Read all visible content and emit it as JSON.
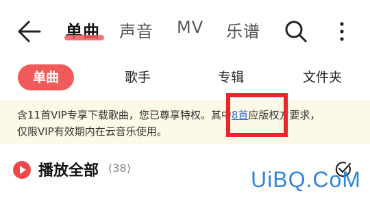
{
  "header": {
    "tabs": [
      {
        "label": "单曲"
      },
      {
        "label": "声音"
      },
      {
        "label": "MV"
      },
      {
        "label": "乐谱"
      }
    ],
    "icons": [
      "back-arrow-icon",
      "search-icon",
      "more-vertical-icon"
    ],
    "accent_color": "#f05a5a"
  },
  "subtabs": [
    {
      "label": "单曲"
    },
    {
      "label": "歌手"
    },
    {
      "label": "专辑"
    },
    {
      "label": "文件夹"
    }
  ],
  "notice": {
    "line1_prefix": "含11首VIP专享下载歌曲，您已尊享特权。",
    "line1_mid": "其中",
    "line1_link": "8首",
    "line1_suffix": "应版权方要求，",
    "line2": "仅限VIP有效期内在云音乐使用。",
    "background_color": "#fdf9e7",
    "highlight_color": "#e8262b"
  },
  "playall": {
    "label": "播放全部",
    "count": "(38)"
  },
  "watermark": "UiBQ.CoM"
}
